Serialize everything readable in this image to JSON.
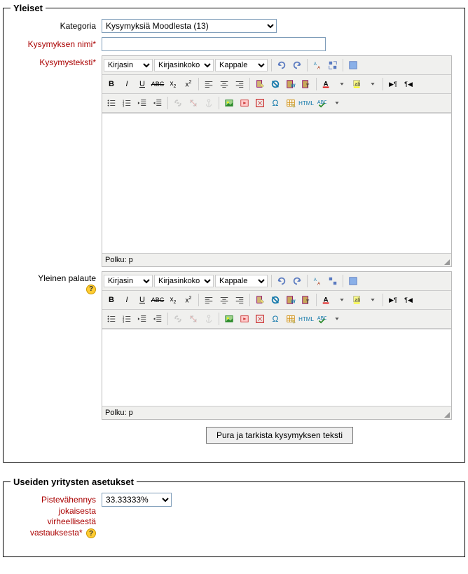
{
  "general": {
    "legend": "Yleiset",
    "labels": {
      "category": "Kategoria",
      "name": "Kysymyksen nimi",
      "text": "Kysymysteksti",
      "feedback": "Yleinen palaute"
    },
    "category_value": "Kysymyksiä Moodlesta (13)",
    "name_value": "",
    "editor": {
      "font_label": "Kirjasin",
      "size_label": "Kirjasinkoko",
      "para_label": "Kappale",
      "path_label": "Polku: p"
    },
    "submit_button": "Pura ja tarkista kysymyksen teksti"
  },
  "multitry": {
    "legend": "Useiden yritysten asetukset",
    "penalty_label": "Pistevähennys jokaisesta virheellisestä vastauksesta",
    "penalty_value": "33.33333%"
  }
}
